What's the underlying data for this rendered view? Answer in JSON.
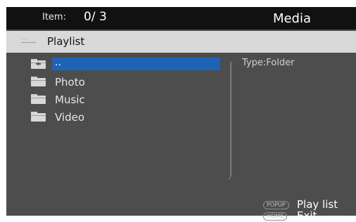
{
  "header": {
    "item_label": "Item:",
    "item_count": "0/ 3",
    "title": "Media"
  },
  "path": {
    "label": "Playlist",
    "icon": "folder-icon"
  },
  "list": {
    "items": [
      {
        "label": "..",
        "icon": "parent-folder-icon",
        "selected": true
      },
      {
        "label": "Photo",
        "icon": "folder-icon"
      },
      {
        "label": "Music",
        "icon": "folder-icon"
      },
      {
        "label": "Video",
        "icon": "folder-icon"
      }
    ]
  },
  "info": {
    "type": "Type:Folder"
  },
  "hints": [
    {
      "key": "POPUP",
      "label": "Play list"
    },
    {
      "key": "HOME",
      "label": "Exit"
    }
  ],
  "colors": {
    "selection": "#1f63b5",
    "header_bg": "#111111",
    "panel_bg": "#4d4d4d",
    "pathbar_bg": "#d9d9d9"
  }
}
